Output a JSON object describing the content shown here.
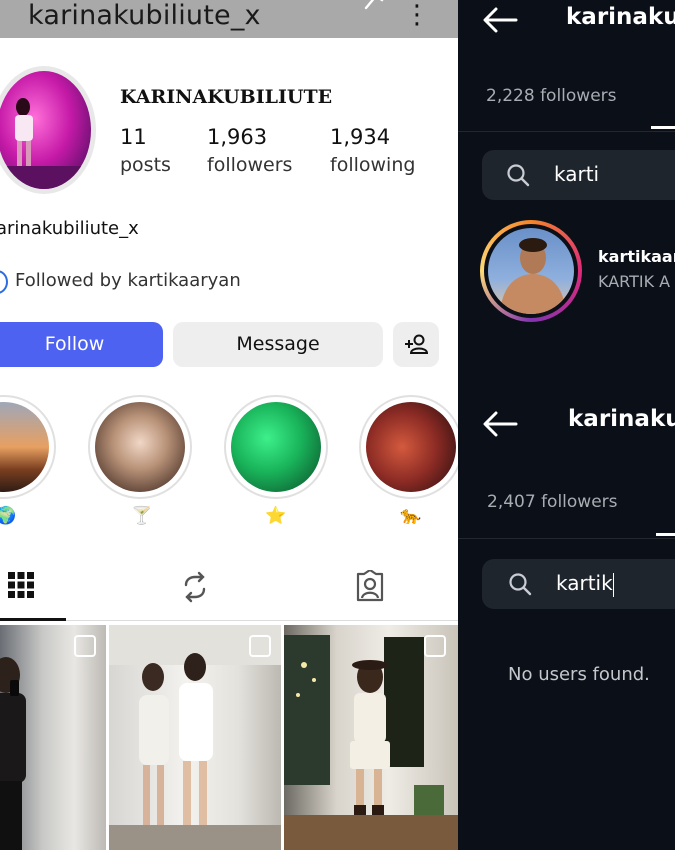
{
  "left": {
    "top_username": "karinakubiliute_x",
    "profile_name": "KARINAKUBILIUTE",
    "stats": [
      {
        "value": "11",
        "label": "posts"
      },
      {
        "value": "1,963",
        "label": "followers"
      },
      {
        "value": "1,934",
        "label": "following"
      }
    ],
    "handle": "arinakubiliute_x",
    "followed_by": "Followed by kartikaaryan",
    "buttons": {
      "follow": "Follow",
      "message": "Message"
    },
    "highlights": [
      {
        "emoji": "🌍"
      },
      {
        "emoji": "🍸"
      },
      {
        "emoji": "⭐"
      },
      {
        "emoji": "🐆"
      }
    ],
    "tabs": [
      {
        "icon": "grid-icon"
      },
      {
        "icon": "reels-icon"
      },
      {
        "icon": "tagged-icon"
      }
    ]
  },
  "right": {
    "top": {
      "title": "karinaku",
      "followers": "2,228 followers",
      "search_value": "karti",
      "result_username": "kartikaar",
      "result_fullname": "KARTIK A"
    },
    "bottom": {
      "title": "karinaku",
      "followers": "2,407 followers",
      "search_value": "kartik",
      "empty_text": "No users found."
    }
  },
  "colors": {
    "follow_button": "#4d62f0",
    "dark_bg": "#0b0f17",
    "search_bg": "#1f252d"
  }
}
